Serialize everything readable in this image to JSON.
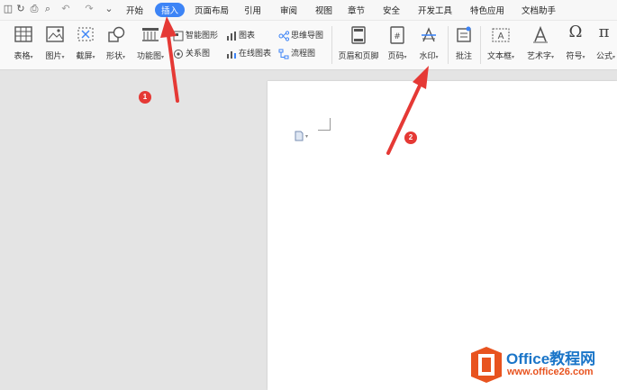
{
  "menubar": {
    "tabs": [
      {
        "label": "开始"
      },
      {
        "label": "插入"
      },
      {
        "label": "页面布局"
      },
      {
        "label": "引用"
      },
      {
        "label": "审阅"
      },
      {
        "label": "视图"
      },
      {
        "label": "章节"
      },
      {
        "label": "安全"
      },
      {
        "label": "开发工具"
      },
      {
        "label": "特色应用"
      },
      {
        "label": "文档助手"
      }
    ],
    "active_tab": "插入"
  },
  "ribbon": {
    "table": "表格",
    "picture": "图片",
    "screenshot": "截屏",
    "shape": "形状",
    "function_chart": "功能图",
    "smart_graphic": "智能图形",
    "chart": "图表",
    "mind_map": "思维导图",
    "relation_chart": "关系图",
    "online_chart": "在线图表",
    "flowchart": "流程图",
    "header_footer": "页眉和页脚",
    "page_number": "页码",
    "watermark": "水印",
    "comment": "批注",
    "text_box": "文本框",
    "art_text": "艺术字",
    "symbol": "符号",
    "formula": "公式"
  },
  "annotations": {
    "marker_1": "1",
    "marker_2": "2",
    "arrow_color": "#e53935"
  },
  "watermark_logo": {
    "brand": "Office教程网",
    "url": "www.office26.com",
    "brand_color": "#1a75c8",
    "icon_color": "#e8531f"
  }
}
